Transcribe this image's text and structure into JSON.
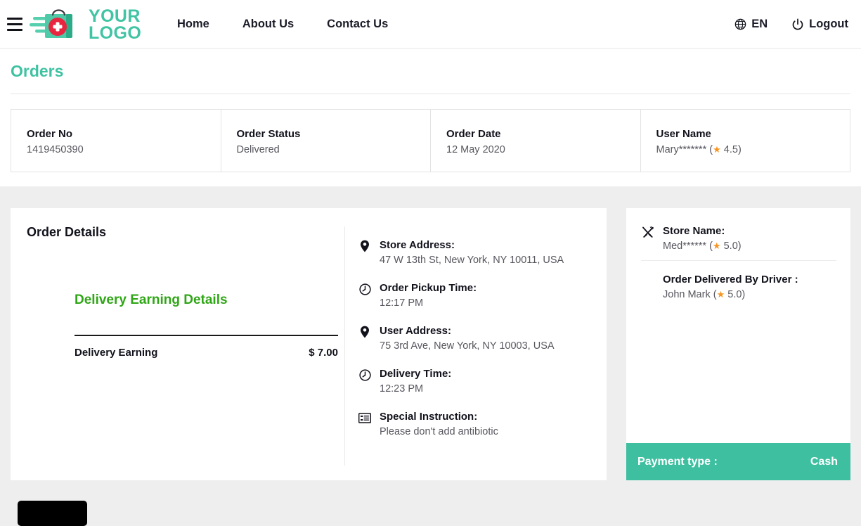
{
  "header": {
    "menu_icon": "hamburger-icon",
    "logo_text_line1": "YOUR",
    "logo_text_line2": "LOGO",
    "nav": [
      {
        "label": "Home"
      },
      {
        "label": "About Us"
      },
      {
        "label": "Contact Us"
      }
    ],
    "language": {
      "icon": "globe-icon",
      "label": "EN"
    },
    "logout": {
      "icon": "power-icon",
      "label": "Logout"
    }
  },
  "page": {
    "title": "Orders"
  },
  "summary": {
    "cells": [
      {
        "label": "Order No",
        "value": "1419450390"
      },
      {
        "label": "Order Status",
        "value": "Delivered"
      },
      {
        "label": "Order Date",
        "value": "12 May 2020"
      },
      {
        "label": "User Name",
        "value_prefix": "Mary******* (",
        "rating": "4.5",
        "value_suffix": ")",
        "star_icon": "star-icon"
      }
    ]
  },
  "order_details": {
    "title": "Order Details",
    "earning": {
      "title": "Delivery Earning Details",
      "row_label": "Delivery Earning",
      "row_value": "$ 7.00"
    },
    "info_items": [
      {
        "icon": "map-pin-icon",
        "label": "Store Address:",
        "value": "47 W 13th St, New York, NY 10011, USA"
      },
      {
        "icon": "clock-icon",
        "label": "Order Pickup Time:",
        "value": "12:17 PM"
      },
      {
        "icon": "map-pin-icon",
        "label": "User Address:",
        "value": "75 3rd Ave, New York, NY 10003, USA"
      },
      {
        "icon": "clock-icon",
        "label": "Delivery Time:",
        "value": "12:23 PM"
      },
      {
        "icon": "list-icon",
        "label": "Special Instruction:",
        "value": "Please don't add antibiotic"
      }
    ]
  },
  "right_panel": {
    "store": {
      "icon": "cutlery-icon",
      "label": "Store Name:",
      "name_prefix": "Med****** (",
      "rating": "5.0",
      "name_suffix": ")",
      "star_icon": "star-icon"
    },
    "driver": {
      "label": "Order Delivered By Driver :",
      "name_prefix": "John Mark (",
      "rating": "5.0",
      "name_suffix": ")",
      "star_icon": "star-icon"
    },
    "payment": {
      "label": "Payment type :",
      "value": "Cash"
    }
  },
  "colors": {
    "brand_teal": "#3dbfa0",
    "title_teal": "#3fc2a2",
    "earning_green": "#2fa616",
    "star_orange": "#f7941e",
    "page_bg": "#eeeeee"
  }
}
